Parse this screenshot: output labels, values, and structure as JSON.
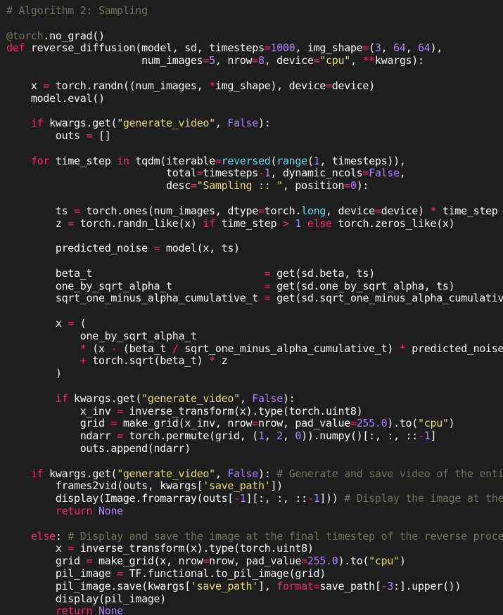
{
  "palette": {
    "background": "#1e1e1e",
    "plain": "#f8f8f2",
    "comment": "#75715e",
    "keyword": "#f92672",
    "string": "#e6db74",
    "number": "#ae81ff",
    "builtin": "#66d9ef"
  },
  "code": {
    "lines": [
      {
        "tokens": [
          [
            "comment",
            "# Algorithm 2: Sampling"
          ]
        ]
      },
      {
        "tokens": []
      },
      {
        "tokens": [
          [
            "decor",
            "@torch"
          ],
          [
            "plain",
            ".no_grad()"
          ]
        ]
      },
      {
        "tokens": [
          [
            "keyword",
            "def"
          ],
          [
            "plain",
            " reverse_diffusion(model, sd, timesteps"
          ],
          [
            "op",
            "="
          ],
          [
            "number",
            "1000"
          ],
          [
            "plain",
            ", img_shape"
          ],
          [
            "op",
            "="
          ],
          [
            "plain",
            "("
          ],
          [
            "number",
            "3"
          ],
          [
            "plain",
            ", "
          ],
          [
            "number",
            "64"
          ],
          [
            "plain",
            ", "
          ],
          [
            "number",
            "64"
          ],
          [
            "plain",
            "),"
          ]
        ]
      },
      {
        "tokens": [
          [
            "plain",
            "                      num_images"
          ],
          [
            "op",
            "="
          ],
          [
            "number",
            "5"
          ],
          [
            "plain",
            ", nrow"
          ],
          [
            "op",
            "="
          ],
          [
            "number",
            "8"
          ],
          [
            "plain",
            ", device"
          ],
          [
            "op",
            "="
          ],
          [
            "string",
            "\"cpu\""
          ],
          [
            "plain",
            ", "
          ],
          [
            "op",
            "**"
          ],
          [
            "plain",
            "kwargs):"
          ]
        ]
      },
      {
        "tokens": []
      },
      {
        "tokens": [
          [
            "plain",
            "    x "
          ],
          [
            "op",
            "="
          ],
          [
            "plain",
            " torch.randn((num_images, "
          ],
          [
            "op",
            "*"
          ],
          [
            "plain",
            "img_shape), device"
          ],
          [
            "op",
            "="
          ],
          [
            "plain",
            "device)"
          ]
        ]
      },
      {
        "tokens": [
          [
            "plain",
            "    model.eval()"
          ]
        ]
      },
      {
        "tokens": []
      },
      {
        "tokens": [
          [
            "plain",
            "    "
          ],
          [
            "keyword",
            "if"
          ],
          [
            "plain",
            " kwargs.get("
          ],
          [
            "string",
            "\"generate_video\""
          ],
          [
            "plain",
            ", "
          ],
          [
            "const",
            "False"
          ],
          [
            "plain",
            "):"
          ]
        ]
      },
      {
        "tokens": [
          [
            "plain",
            "        outs "
          ],
          [
            "op",
            "="
          ],
          [
            "plain",
            " []"
          ]
        ]
      },
      {
        "tokens": []
      },
      {
        "tokens": [
          [
            "plain",
            "    "
          ],
          [
            "keyword",
            "for"
          ],
          [
            "plain",
            " time_step "
          ],
          [
            "keyword",
            "in"
          ],
          [
            "plain",
            " tqdm(iterable"
          ],
          [
            "op",
            "="
          ],
          [
            "builtin",
            "reversed"
          ],
          [
            "plain",
            "("
          ],
          [
            "builtin",
            "range"
          ],
          [
            "plain",
            "("
          ],
          [
            "number",
            "1"
          ],
          [
            "plain",
            ", timesteps)),"
          ]
        ]
      },
      {
        "tokens": [
          [
            "plain",
            "                          total"
          ],
          [
            "op",
            "="
          ],
          [
            "plain",
            "timesteps"
          ],
          [
            "op",
            "-"
          ],
          [
            "number",
            "1"
          ],
          [
            "plain",
            ", dynamic_ncols"
          ],
          [
            "op",
            "="
          ],
          [
            "const",
            "False"
          ],
          [
            "plain",
            ","
          ]
        ]
      },
      {
        "tokens": [
          [
            "plain",
            "                          desc"
          ],
          [
            "op",
            "="
          ],
          [
            "string",
            "\"Sampling :: \""
          ],
          [
            "plain",
            ", position"
          ],
          [
            "op",
            "="
          ],
          [
            "number",
            "0"
          ],
          [
            "plain",
            "):"
          ]
        ]
      },
      {
        "tokens": []
      },
      {
        "tokens": [
          [
            "plain",
            "        ts "
          ],
          [
            "op",
            "="
          ],
          [
            "plain",
            " torch.ones(num_images, dtype"
          ],
          [
            "op",
            "="
          ],
          [
            "plain",
            "torch."
          ],
          [
            "builtin",
            "long"
          ],
          [
            "plain",
            ", device"
          ],
          [
            "op",
            "="
          ],
          [
            "plain",
            "device) "
          ],
          [
            "op",
            "*"
          ],
          [
            "plain",
            " time_step"
          ]
        ]
      },
      {
        "tokens": [
          [
            "plain",
            "        z "
          ],
          [
            "op",
            "="
          ],
          [
            "plain",
            " torch.randn_like(x) "
          ],
          [
            "keyword",
            "if"
          ],
          [
            "plain",
            " time_step "
          ],
          [
            "op",
            ">"
          ],
          [
            "plain",
            " "
          ],
          [
            "number",
            "1"
          ],
          [
            "plain",
            " "
          ],
          [
            "keyword",
            "else"
          ],
          [
            "plain",
            " torch.zeros_like(x)"
          ]
        ]
      },
      {
        "tokens": []
      },
      {
        "tokens": [
          [
            "plain",
            "        predicted_noise "
          ],
          [
            "op",
            "="
          ],
          [
            "plain",
            " model(x, ts)"
          ]
        ]
      },
      {
        "tokens": []
      },
      {
        "tokens": [
          [
            "plain",
            "        beta_t                            "
          ],
          [
            "op",
            "="
          ],
          [
            "plain",
            " get(sd.beta, ts)"
          ]
        ]
      },
      {
        "tokens": [
          [
            "plain",
            "        one_by_sqrt_alpha_t               "
          ],
          [
            "op",
            "="
          ],
          [
            "plain",
            " get(sd.one_by_sqrt_alpha, ts)"
          ]
        ]
      },
      {
        "tokens": [
          [
            "plain",
            "        sqrt_one_minus_alpha_cumulative_t "
          ],
          [
            "op",
            "="
          ],
          [
            "plain",
            " get(sd.sqrt_one_minus_alpha_cumulative_t, ts)"
          ]
        ]
      },
      {
        "tokens": []
      },
      {
        "tokens": [
          [
            "plain",
            "        x "
          ],
          [
            "op",
            "="
          ],
          [
            "plain",
            " ("
          ]
        ]
      },
      {
        "tokens": [
          [
            "plain",
            "            one_by_sqrt_alpha_t"
          ]
        ]
      },
      {
        "tokens": [
          [
            "plain",
            "            "
          ],
          [
            "op",
            "*"
          ],
          [
            "plain",
            " (x "
          ],
          [
            "op",
            "-"
          ],
          [
            "plain",
            " (beta_t "
          ],
          [
            "op",
            "/"
          ],
          [
            "plain",
            " sqrt_one_minus_alpha_cumulative_t) "
          ],
          [
            "op",
            "*"
          ],
          [
            "plain",
            " predicted_noise)"
          ]
        ]
      },
      {
        "tokens": [
          [
            "plain",
            "            "
          ],
          [
            "op",
            "+"
          ],
          [
            "plain",
            " torch.sqrt(beta_t) "
          ],
          [
            "op",
            "*"
          ],
          [
            "plain",
            " z"
          ]
        ]
      },
      {
        "tokens": [
          [
            "plain",
            "        )"
          ]
        ]
      },
      {
        "tokens": []
      },
      {
        "tokens": [
          [
            "plain",
            "        "
          ],
          [
            "keyword",
            "if"
          ],
          [
            "plain",
            " kwargs.get("
          ],
          [
            "string",
            "\"generate_video\""
          ],
          [
            "plain",
            ", "
          ],
          [
            "const",
            "False"
          ],
          [
            "plain",
            "):"
          ]
        ]
      },
      {
        "tokens": [
          [
            "plain",
            "            x_inv "
          ],
          [
            "op",
            "="
          ],
          [
            "plain",
            " inverse_transform(x).type(torch.uint8)"
          ]
        ]
      },
      {
        "tokens": [
          [
            "plain",
            "            grid "
          ],
          [
            "op",
            "="
          ],
          [
            "plain",
            " make_grid(x_inv, nrow"
          ],
          [
            "op",
            "="
          ],
          [
            "plain",
            "nrow, pad_value"
          ],
          [
            "op",
            "="
          ],
          [
            "number",
            "255.0"
          ],
          [
            "plain",
            ").to("
          ],
          [
            "string",
            "\"cpu\""
          ],
          [
            "plain",
            ")"
          ]
        ]
      },
      {
        "tokens": [
          [
            "plain",
            "            ndarr "
          ],
          [
            "op",
            "="
          ],
          [
            "plain",
            " torch.permute(grid, ("
          ],
          [
            "number",
            "1"
          ],
          [
            "plain",
            ", "
          ],
          [
            "number",
            "2"
          ],
          [
            "plain",
            ", "
          ],
          [
            "number",
            "0"
          ],
          [
            "plain",
            ")).numpy()[:, :, ::"
          ],
          [
            "op",
            "-"
          ],
          [
            "number",
            "1"
          ],
          [
            "plain",
            "]"
          ]
        ]
      },
      {
        "tokens": [
          [
            "plain",
            "            outs.append(ndarr)"
          ]
        ]
      },
      {
        "tokens": []
      },
      {
        "tokens": [
          [
            "plain",
            "    "
          ],
          [
            "keyword",
            "if"
          ],
          [
            "plain",
            " kwargs.get("
          ],
          [
            "string",
            "\"generate_video\""
          ],
          [
            "plain",
            ", "
          ],
          [
            "const",
            "False"
          ],
          [
            "plain",
            "): "
          ],
          [
            "comment",
            "# Generate and save video of the entire reverse process"
          ]
        ]
      },
      {
        "tokens": [
          [
            "plain",
            "        frames2vid(outs, kwargs["
          ],
          [
            "string",
            "'save_path'"
          ],
          [
            "plain",
            "])"
          ]
        ]
      },
      {
        "tokens": [
          [
            "plain",
            "        display(Image.fromarray(outs["
          ],
          [
            "op",
            "-"
          ],
          [
            "number",
            "1"
          ],
          [
            "plain",
            "][:, :, ::"
          ],
          [
            "op",
            "-"
          ],
          [
            "number",
            "1"
          ],
          [
            "plain",
            "])) "
          ],
          [
            "comment",
            "# Display the image at the final timestep"
          ]
        ]
      },
      {
        "tokens": [
          [
            "plain",
            "        "
          ],
          [
            "keyword",
            "return"
          ],
          [
            "plain",
            " "
          ],
          [
            "const",
            "None"
          ]
        ]
      },
      {
        "tokens": []
      },
      {
        "tokens": [
          [
            "plain",
            "    "
          ],
          [
            "keyword",
            "else"
          ],
          [
            "plain",
            ": "
          ],
          [
            "comment",
            "# Display and save the image at the final timestep of the reverse process"
          ]
        ]
      },
      {
        "tokens": [
          [
            "plain",
            "        x "
          ],
          [
            "op",
            "="
          ],
          [
            "plain",
            " inverse_transform(x).type(torch.uint8)"
          ]
        ]
      },
      {
        "tokens": [
          [
            "plain",
            "        grid "
          ],
          [
            "op",
            "="
          ],
          [
            "plain",
            " make_grid(x, nrow"
          ],
          [
            "op",
            "="
          ],
          [
            "plain",
            "nrow, pad_value"
          ],
          [
            "op",
            "="
          ],
          [
            "number",
            "255.0"
          ],
          [
            "plain",
            ").to("
          ],
          [
            "string",
            "\"cpu\""
          ],
          [
            "plain",
            ")"
          ]
        ]
      },
      {
        "tokens": [
          [
            "plain",
            "        pil_image "
          ],
          [
            "op",
            "="
          ],
          [
            "plain",
            " TF.functional.to_pil_image(grid)"
          ]
        ]
      },
      {
        "tokens": [
          [
            "plain",
            "        pil_image.save(kwargs["
          ],
          [
            "string",
            "'save_path'"
          ],
          [
            "plain",
            "], "
          ],
          [
            "keyword",
            "format"
          ],
          [
            "op",
            "="
          ],
          [
            "plain",
            "save_path["
          ],
          [
            "op",
            "-"
          ],
          [
            "number",
            "3"
          ],
          [
            "plain",
            ":].upper())"
          ]
        ]
      },
      {
        "tokens": [
          [
            "plain",
            "        display(pil_image)"
          ]
        ]
      },
      {
        "tokens": [
          [
            "plain",
            "        "
          ],
          [
            "keyword",
            "return"
          ],
          [
            "plain",
            " "
          ],
          [
            "const",
            "None"
          ]
        ]
      }
    ]
  }
}
